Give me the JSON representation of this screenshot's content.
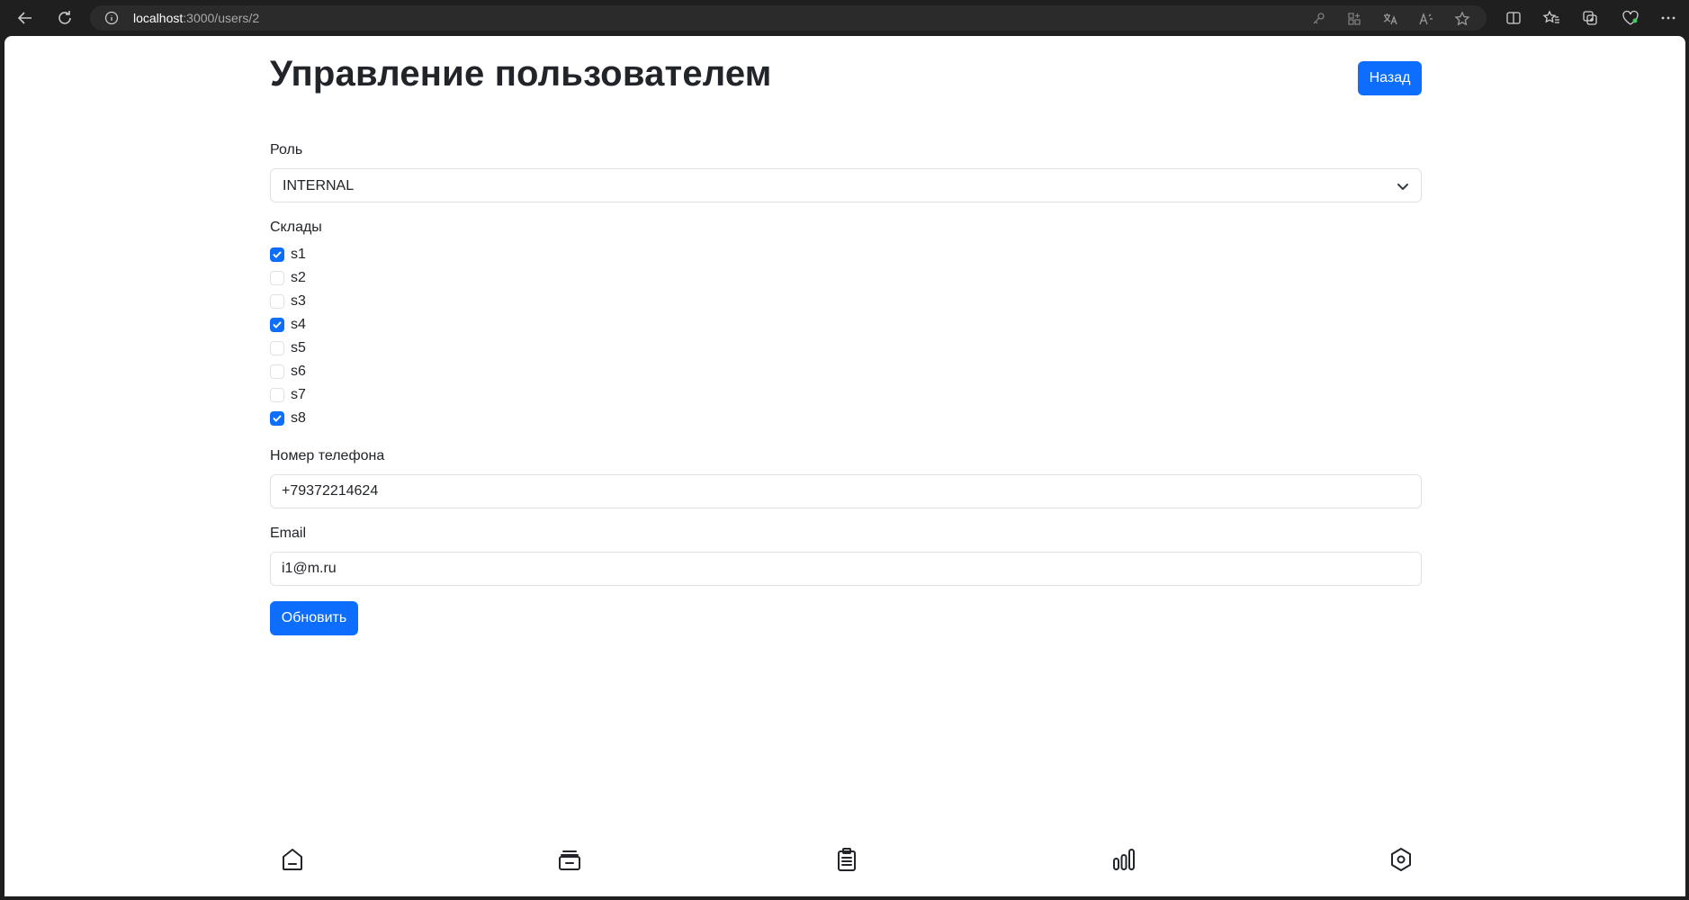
{
  "browser": {
    "url_host": "localhost",
    "url_path": ":3000/users/2"
  },
  "page": {
    "title": "Управление пользователем",
    "back_label": "Назад"
  },
  "form": {
    "role": {
      "label": "Роль",
      "value": "INTERNAL"
    },
    "warehouses": {
      "label": "Склады",
      "items": [
        {
          "label": "s1",
          "checked": true
        },
        {
          "label": "s2",
          "checked": false
        },
        {
          "label": "s3",
          "checked": false
        },
        {
          "label": "s4",
          "checked": true
        },
        {
          "label": "s5",
          "checked": false
        },
        {
          "label": "s6",
          "checked": false
        },
        {
          "label": "s7",
          "checked": false
        },
        {
          "label": "s8",
          "checked": true
        }
      ]
    },
    "phone": {
      "label": "Номер телефона",
      "value": "+79372214624"
    },
    "email": {
      "label": "Email",
      "value": "i1@m.ru"
    },
    "submit_label": "Обновить"
  },
  "bottom_nav": {
    "items": [
      {
        "icon": "home-icon"
      },
      {
        "icon": "inbox-icon"
      },
      {
        "icon": "clipboard-icon"
      },
      {
        "icon": "chart-icon"
      },
      {
        "icon": "settings-icon"
      }
    ]
  },
  "colors": {
    "primary": "#0d6efd",
    "text": "#212529",
    "border": "#dee2e6"
  }
}
